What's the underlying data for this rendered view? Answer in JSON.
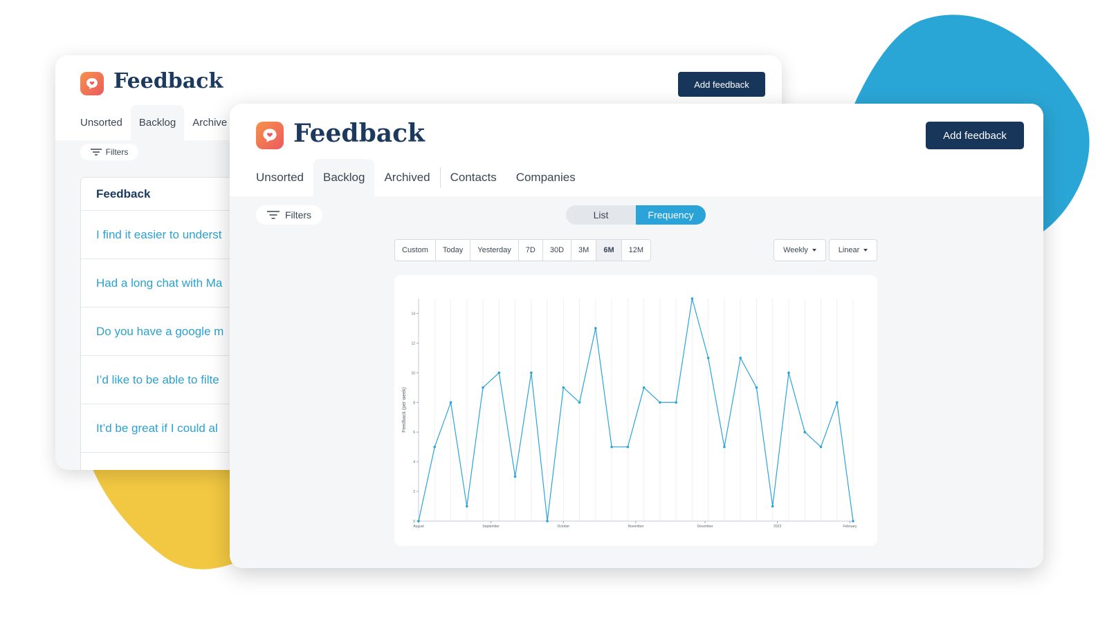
{
  "back_window": {
    "title": "Feedback",
    "add_button": "Add feedback",
    "tabs": [
      "Unsorted",
      "Backlog",
      "Archive"
    ],
    "active_tab": 1,
    "filters_label": "Filters",
    "list_header": "Feedback",
    "items": [
      "I find it easier to underst",
      "Had a long chat with Ma",
      "Do you have a google m",
      "I’d like to be able to filte",
      "It’d be great if I could al"
    ]
  },
  "front_window": {
    "title": "Feedback",
    "add_button": "Add feedback",
    "tabs": [
      "Unsorted",
      "Backlog",
      "Archived",
      "Contacts",
      "Companies"
    ],
    "active_tab": 1,
    "filters_label": "Filters",
    "view_toggle": {
      "list": "List",
      "frequency": "Frequency",
      "selected": "Frequency"
    },
    "ranges": [
      "Custom",
      "Today",
      "Yesterday",
      "7D",
      "30D",
      "3M",
      "6M",
      "12M"
    ],
    "active_range": "6M",
    "interval_select": "Weekly",
    "scale_select": "Linear"
  },
  "colors": {
    "brand_navy": "#17365a",
    "accent_blue": "#2aa4d8",
    "link_blue": "#2aa1cf",
    "logo_orange": "#f0734f",
    "blob_blue": "#2aa6d6",
    "blob_yellow": "#f2c842"
  },
  "chart_data": {
    "type": "line",
    "ylabel": "Feedback (per week)",
    "ylim": [
      0,
      15
    ],
    "yticks": [
      0,
      2,
      4,
      6,
      8,
      10,
      12,
      14
    ],
    "grid": "vertical",
    "x_labels": [
      "August",
      "September",
      "October",
      "November",
      "December",
      "2023",
      "February"
    ],
    "x_label_positions": [
      0,
      4.5,
      9,
      13.5,
      17.8,
      22.3,
      26.8
    ],
    "x": [
      0,
      1,
      2,
      3,
      4,
      5,
      6,
      7,
      8,
      9,
      10,
      11,
      12,
      13,
      14,
      15,
      16,
      17,
      18,
      19,
      20,
      21,
      22,
      23,
      24,
      25,
      26,
      27
    ],
    "series": [
      {
        "values": [
          0,
          5,
          8,
          1,
          9,
          10,
          3,
          10,
          0,
          9,
          8,
          13,
          5,
          5,
          9,
          8,
          8,
          15,
          11,
          5,
          11,
          9,
          1,
          10,
          6,
          5,
          8,
          0
        ]
      }
    ]
  }
}
